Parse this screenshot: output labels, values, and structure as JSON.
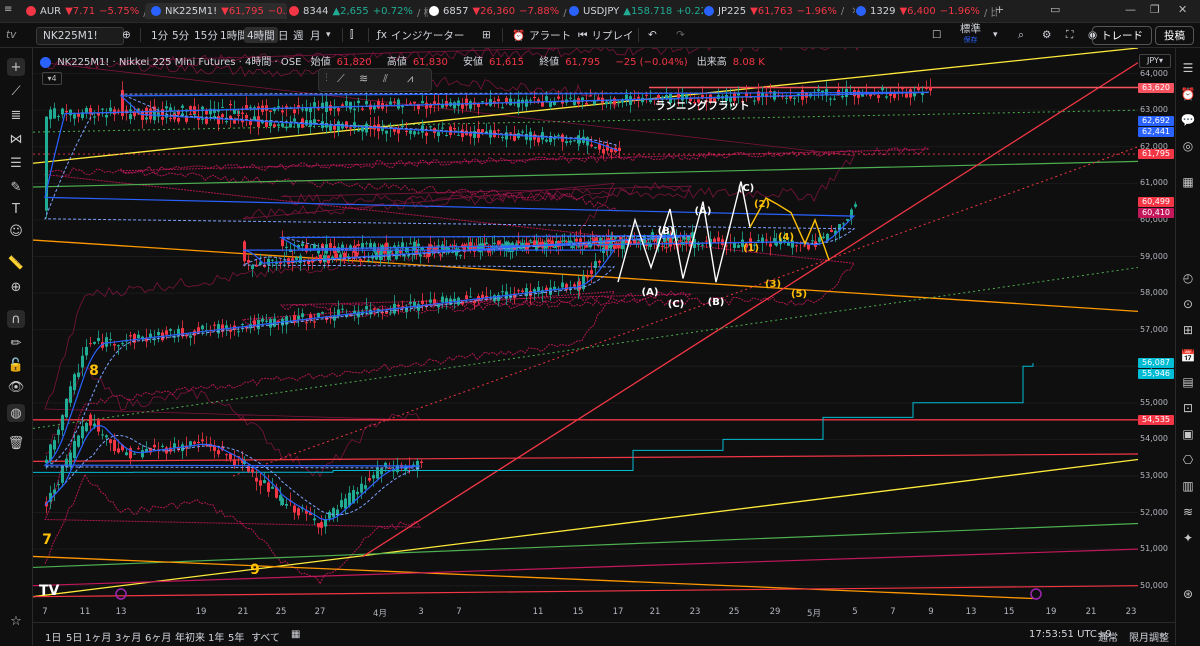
{
  "tabs": [
    {
      "symbol": "AUR",
      "price": "7.71",
      "change": "−5.75%",
      "extra": "/ 標準",
      "dir": "neg",
      "icon_color": "#f23645"
    },
    {
      "symbol": "NK225M1!",
      "price": "61,795",
      "change": "−0.39%",
      "extra": "",
      "dir": "neg",
      "icon_color": "#2962ff",
      "active": true
    },
    {
      "symbol": "8344",
      "price": "2,655",
      "change": "+0.72%",
      "extra": "/ 標準",
      "dir": "pos",
      "icon_color": "#f23645"
    },
    {
      "symbol": "6857",
      "price": "26,360",
      "change": "−7.88%",
      "extra": "/ 標",
      "dir": "neg",
      "icon_color": "#ffffff"
    },
    {
      "symbol": "USDJPY",
      "price": "158.718",
      "change": "+0.22%",
      "extra": "",
      "dir": "pos",
      "icon_color": "#2962ff"
    },
    {
      "symbol": "JP225",
      "price": "61,763",
      "change": "−1.96%",
      "extra": "/",
      "dir": "neg",
      "icon_color": "#2962ff"
    },
    {
      "symbol": "1329",
      "price": "6,400",
      "change": "−1.96%",
      "extra": "/ 比較",
      "dir": "neg",
      "icon_color": "#2962ff"
    }
  ],
  "toolbar": {
    "symbol": "NK225M1!",
    "intervals": [
      "1分",
      "5分",
      "15分",
      "1時間",
      "4時間",
      "日",
      "週",
      "月"
    ],
    "active_interval": "4時間",
    "indicators": "インジケーター",
    "alert": "アラート",
    "replay": "リプレイ",
    "layout": "標準",
    "layout_sub": "保存",
    "trade": "トレード",
    "post": "投稿"
  },
  "legend": {
    "title": "NK225M1! · Nikkei 225 Mini Futures · 4時間 · OSE",
    "open_label": "始値",
    "open": "61,820",
    "high_label": "高値",
    "high": "61,830",
    "low_label": "安値",
    "low": "61,615",
    "close_label": "終値",
    "close": "61,795",
    "change": "−25 (−0.04%)",
    "volume_label": "出来高",
    "volume": "8.08 K",
    "indicator_count": "4"
  },
  "currency": "JPY",
  "annotation_title": "ランニングフラット",
  "wave_labels": [
    "(A)",
    "(B)",
    "(C)",
    "(A)",
    "(B)",
    "(C)",
    "(1)",
    "(2)",
    "(3)",
    "(4)",
    "(5)",
    "7",
    "8",
    "9"
  ],
  "price_ticks": [
    "64,000",
    "63,000",
    "62,000",
    "61,000",
    "60,000",
    "59,000",
    "58,000",
    "57,000",
    "56,000",
    "55,000",
    "54,000",
    "53,000",
    "52,000",
    "51,000",
    "50,000"
  ],
  "price_badges": [
    {
      "value": "63,620",
      "color": "#f7525f"
    },
    {
      "value": "62,692",
      "color": "#2962ff"
    },
    {
      "value": "62,441",
      "color": "#2962ff"
    },
    {
      "value": "61,795",
      "color": "#f23645"
    },
    {
      "value": "60,499",
      "color": "#f23645"
    },
    {
      "value": "60,410",
      "color": "#c2185b"
    },
    {
      "value": "56,087",
      "color": "#00bcd4"
    },
    {
      "value": "55,946",
      "color": "#00bcd4"
    },
    {
      "value": "54,535",
      "color": "#f23645"
    }
  ],
  "time_ticks": [
    "7",
    "11",
    "13",
    "19",
    "21",
    "25",
    "27",
    "4月",
    "3",
    "7",
    "11",
    "15",
    "17",
    "21",
    "23",
    "25",
    "29",
    "5月",
    "5",
    "7",
    "9",
    "13",
    "15",
    "19",
    "21",
    "23"
  ],
  "bottom": {
    "ranges": [
      "1日",
      "5日",
      "1ヶ月",
      "3ヶ月",
      "6ヶ月",
      "年初来",
      "1年",
      "5年",
      "すべて"
    ],
    "clock": "17:53:51 UTC+9",
    "session": "通常",
    "adjust": "限月調整"
  },
  "chart_data": {
    "type": "candlestick",
    "ylim": [
      49500,
      64700
    ],
    "x_range_labels": [
      "7",
      "23"
    ],
    "approx_close_path": [
      [
        "7",
        52200
      ],
      [
        "11",
        54600
      ],
      [
        "13",
        53600
      ],
      [
        "19",
        53900
      ],
      [
        "21",
        53300
      ],
      [
        "25",
        52300
      ],
      [
        "27",
        51700
      ],
      [
        "4月",
        53200
      ],
      [
        "3",
        53300
      ],
      [
        "7",
        53400
      ],
      [
        "11",
        56600
      ],
      [
        "15",
        58200
      ],
      [
        "17",
        59700
      ],
      [
        "21",
        58800
      ],
      [
        "23",
        59600
      ],
      [
        "25",
        59200
      ],
      [
        "29",
        59400
      ],
      [
        "5月",
        59300
      ],
      [
        "5",
        60400
      ],
      [
        "7",
        62900
      ],
      [
        "9",
        63500
      ],
      [
        "13",
        62900
      ],
      [
        "15",
        62200
      ],
      [
        "17",
        61795
      ]
    ],
    "horizontal_levels": [
      63620,
      54535,
      53400
    ],
    "colors": {
      "up": "#22ab94",
      "down": "#f23645",
      "ma_fast": "#2962ff",
      "ma_slow": "#7da1ff",
      "ichimoku": "#c2185b",
      "cyan": "#00bcd4"
    }
  }
}
